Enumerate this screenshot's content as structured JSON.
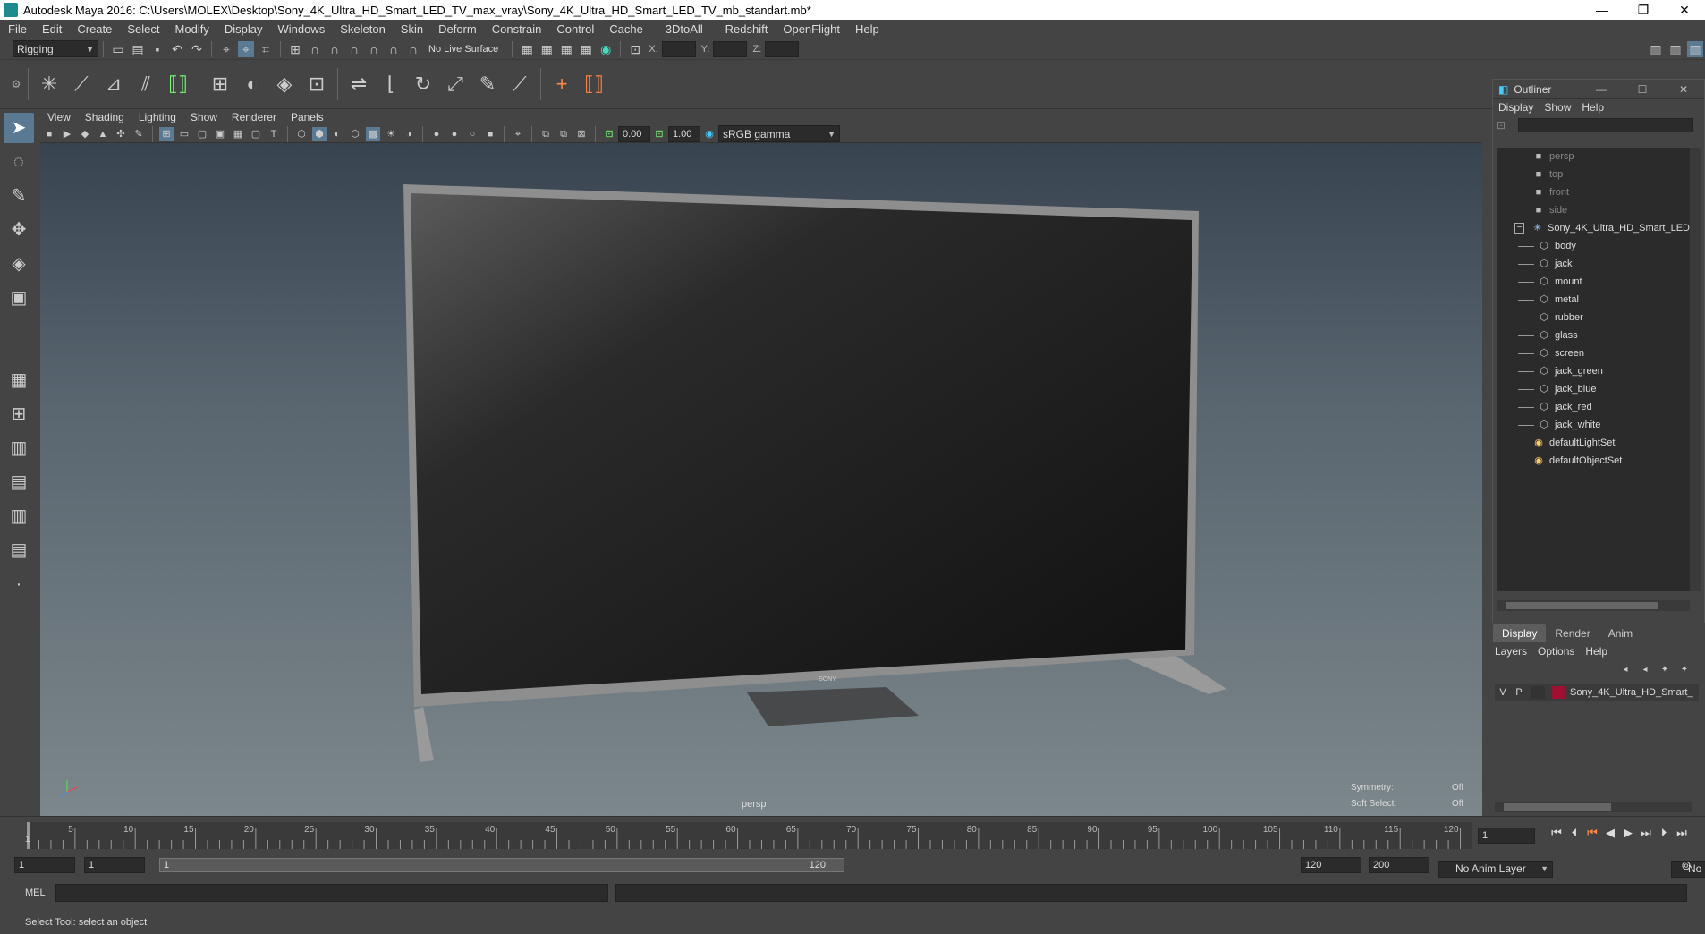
{
  "window": {
    "title": "Autodesk Maya 2016: C:\\Users\\MOLEX\\Desktop\\Sony_4K_Ultra_HD_Smart_LED_TV_max_vray\\Sony_4K_Ultra_HD_Smart_LED_TV_mb_standart.mb*"
  },
  "menubar": [
    "File",
    "Edit",
    "Create",
    "Select",
    "Modify",
    "Display",
    "Windows",
    "Skeleton",
    "Skin",
    "Deform",
    "Constrain",
    "Control",
    "Cache",
    "- 3DtoAll -",
    "Redshift",
    "OpenFlight",
    "Help"
  ],
  "statusline": {
    "menuset": "Rigging",
    "live_surface": "No Live Surface",
    "x_label": "X:",
    "y_label": "Y:",
    "z_label": "Z:"
  },
  "viewport": {
    "menu": [
      "View",
      "Shading",
      "Lighting",
      "Show",
      "Renderer",
      "Panels"
    ],
    "exposure": "0.00",
    "gamma": "1.00",
    "colorspace": "sRGB gamma",
    "camera_label": "persp",
    "tv_brand": "SONY",
    "symmetry_label": "Symmetry:",
    "symmetry_value": "Off",
    "soft_select_label": "Soft Select:",
    "soft_select_value": "Off"
  },
  "outliner": {
    "title": "Outliner",
    "menu": [
      "Display",
      "Show",
      "Help"
    ],
    "cameras": [
      "persp",
      "top",
      "front",
      "side"
    ],
    "group": "Sony_4K_Ultra_HD_Smart_LED",
    "children": [
      "body",
      "jack",
      "mount",
      "metal",
      "rubber",
      "glass",
      "screen",
      "jack_green",
      "jack_blue",
      "jack_red",
      "jack_white"
    ],
    "sets": [
      "defaultLightSet",
      "defaultObjectSet"
    ]
  },
  "layers": {
    "tabs": [
      "Display",
      "Render",
      "Anim"
    ],
    "menu": [
      "Layers",
      "Options",
      "Help"
    ],
    "layer_v": "V",
    "layer_p": "P",
    "layer_name": "Sony_4K_Ultra_HD_Smart_"
  },
  "timeline": {
    "ticks": [
      "5",
      "10",
      "15",
      "20",
      "25",
      "30",
      "35",
      "40",
      "45",
      "50",
      "55",
      "60",
      "65",
      "70",
      "75",
      "80",
      "85",
      "90",
      "95",
      "100",
      "105",
      "110",
      "115",
      "120"
    ],
    "start_marker": "1",
    "current_frame": "1"
  },
  "range": {
    "start": "1",
    "playback_start": "1",
    "slider_start": "1",
    "slider_end": "120",
    "playback_end": "120",
    "end": "200",
    "anim_layer": "No Anim Layer",
    "character_set": "No Character Set"
  },
  "mel": {
    "label": "MEL"
  },
  "help": {
    "text": "Select Tool: select an object"
  }
}
